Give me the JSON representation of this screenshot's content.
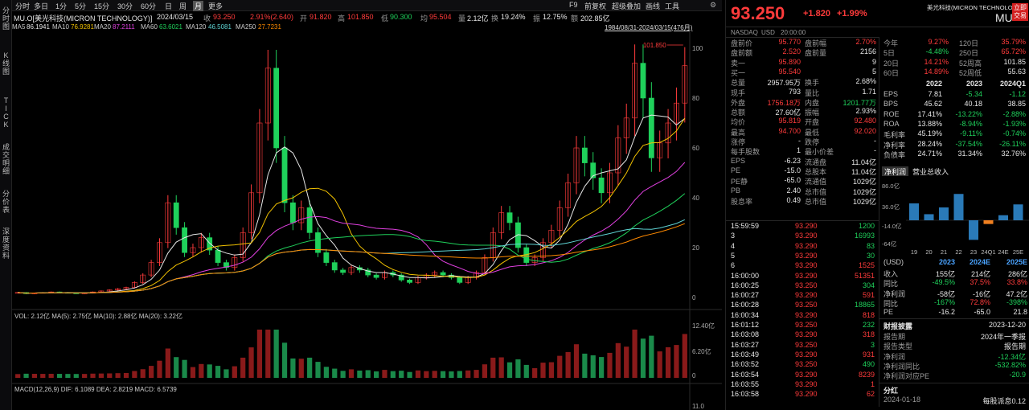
{
  "left_sidebar": [
    "分时图",
    "K线图",
    "TICK",
    "成交明细",
    "分价表",
    "深度资料"
  ],
  "toolbar": {
    "periods": [
      "分时",
      "多日",
      "1分",
      "5分",
      "15分",
      "30分",
      "60分",
      "日",
      "周",
      "月",
      "更多"
    ],
    "active_period": "月",
    "right_items": [
      "F9",
      "前复权",
      "超级叠加",
      "画线",
      "工具"
    ]
  },
  "info": {
    "symbol": "MU.O[美光科技(MICRON TECHNOLOGY)]",
    "date": "2024/03/15",
    "close_label": "收",
    "close": "93.250",
    "change": "2.91%(2.640)",
    "open_label": "开",
    "open": "91.820",
    "high_label": "高",
    "high": "101.850",
    "low_label": "低",
    "low": "90.300",
    "avg_label": "均",
    "avg": "95.504",
    "vol_label": "量",
    "vol": "2.12亿",
    "turnover_label": "换",
    "turnover": "19.24%",
    "amp_label": "振",
    "amp": "12.75%",
    "amount_label": "额",
    "amount": "202.85亿",
    "range": "1984/08/31-2024/03/15(476月)"
  },
  "ma_line": [
    {
      "label": "MA5",
      "value": "86.1941",
      "color": "#e6e6e6"
    },
    {
      "label": "MA10",
      "value": "76.9281",
      "color": "#f2c200"
    },
    {
      "label": "MA20",
      "value": "87.2111",
      "color": "#e040e0"
    },
    {
      "label": "MA60",
      "value": "63.6021",
      "color": "#1fd15b"
    },
    {
      "label": "MA120",
      "value": "46.5081",
      "color": "#5fd5d5"
    },
    {
      "label": "MA250",
      "value": "27.7231",
      "color": "#ff8a00"
    }
  ],
  "chart_data": {
    "type": "candlestick",
    "price_axis_ticks": [
      "100",
      "80",
      "60",
      "40",
      "20",
      "0"
    ],
    "price_ylim": [
      0,
      100
    ],
    "high_annotation": "101.850",
    "price_series_monthly_approx": [
      2,
      1.5,
      1.8,
      2,
      2.2,
      2,
      1.8,
      1.6,
      1.8,
      2.2,
      2.6,
      3,
      3.5,
      4,
      6,
      9,
      14,
      22,
      38,
      28,
      18,
      20,
      24,
      19,
      14,
      12,
      16,
      26,
      42,
      70,
      92,
      60,
      38,
      30,
      36,
      26,
      18,
      14,
      11,
      10,
      12,
      11,
      9,
      8,
      10,
      9,
      7,
      6,
      8,
      9,
      10,
      9,
      8,
      6,
      8,
      10,
      16,
      26,
      34,
      30,
      20,
      14,
      16,
      22,
      27,
      36,
      46,
      60,
      54,
      48,
      42,
      50,
      64,
      72,
      94,
      80,
      56,
      62,
      70,
      78,
      93
    ],
    "volume_label": "VOL: 2.12亿 MA(5): 2.75亿 MA(10): 2.88亿 MA(20): 3.22亿",
    "volume_axis_ticks": [
      "12.40亿",
      "6.20亿",
      "0"
    ],
    "macd_label": "MACD(12,26,9) DIF: 6.1089 DEA: 2.8219 MACD: 6.5739",
    "macd_axis_ticks": [
      "11.0"
    ]
  },
  "quote": {
    "price": "93.250",
    "change": "+1.820",
    "change_pct": "+1.99%",
    "name": "美光科技(MICRON TECHNOLOGY)",
    "ticker": "MU",
    "trade_button": "立即交易",
    "exchange": "NASDAQ",
    "currency": "USD",
    "time": "20:00:00",
    "left_rows": [
      {
        "label": "盘前价",
        "value": "95.770",
        "value2_label": "盘前幅",
        "value2": "2.70%",
        "c1": "red",
        "c2": "red"
      },
      {
        "label": "盘前额",
        "value": "2.520",
        "value2_label": "盘前量",
        "value2": "2156",
        "c1": "red",
        "c2": "white"
      },
      {
        "label": "卖一",
        "value": "95.890",
        "value2_label": "",
        "value2": "9",
        "c1": "red",
        "c2": "white"
      },
      {
        "label": "买一",
        "value": "95.540",
        "value2_label": "",
        "value2": "5",
        "c1": "red",
        "c2": "white"
      },
      {
        "label": "总量",
        "value": "2957.95万",
        "value2_label": "换手",
        "value2": "2.68%",
        "c1": "white",
        "c2": "white"
      },
      {
        "label": "现手",
        "value": "793",
        "value2_label": "量比",
        "value2": "1.71",
        "c1": "white",
        "c2": "white"
      },
      {
        "label": "外盘",
        "value": "1756.18万",
        "value2_label": "内盘",
        "value2": "1201.77万",
        "c1": "red",
        "c2": "green"
      },
      {
        "label": "总额",
        "value": "27.60亿",
        "value2_label": "振幅",
        "value2": "2.93%",
        "c1": "white",
        "c2": "white"
      },
      {
        "label": "均价",
        "value": "95.819",
        "value2_label": "开盘",
        "value2": "92.480",
        "c1": "red",
        "c2": "red"
      },
      {
        "label": "最高",
        "value": "94.700",
        "value2_label": "最低",
        "value2": "92.020",
        "c1": "red",
        "c2": "red"
      },
      {
        "label": "涨停",
        "value": "-",
        "value2_label": "跌停",
        "value2": "-",
        "c1": "white",
        "c2": "white"
      },
      {
        "label": "每手股数",
        "value": "1",
        "value2_label": "最小价差",
        "value2": "-",
        "c1": "white",
        "c2": "white"
      },
      {
        "label": "EPS",
        "value": "-6.23",
        "value2_label": "流通盘",
        "value2": "11.04亿",
        "c1": "white",
        "c2": "white"
      },
      {
        "label": "PE",
        "value": "-15.0",
        "value2_label": "总股本",
        "value2": "11.04亿",
        "c1": "white",
        "c2": "white"
      },
      {
        "label": "PE静",
        "value": "-65.0",
        "value2_label": "流通值",
        "value2": "1029亿",
        "c1": "white",
        "c2": "white"
      },
      {
        "label": "PB",
        "value": "2.40",
        "value2_label": "总市值",
        "value2": "1029亿",
        "c1": "white",
        "c2": "white"
      },
      {
        "label": "股息率",
        "value": "0.49",
        "value2_label": "总市值",
        "value2": "1029亿",
        "c1": "white",
        "c2": "white"
      }
    ],
    "perf": [
      {
        "l1": "今年",
        "v1": "9.27%",
        "l2": "120日",
        "v2": "35.79%"
      },
      {
        "l1": "5日",
        "v1": "-4.48%",
        "l2": "250日",
        "v2": "65.72%"
      },
      {
        "l1": "20日",
        "v1": "14.21%",
        "l2": "52周高",
        "v2": "101.85"
      },
      {
        "l1": "60日",
        "v1": "14.89%",
        "l2": "52周低",
        "v2": "55.63"
      }
    ],
    "fin_head": [
      "",
      "2022",
      "2023",
      "2024Q1"
    ],
    "fin_rows": [
      [
        "EPS",
        "7.81",
        "-5.34",
        "-1.12"
      ],
      [
        "BPS",
        "45.62",
        "40.18",
        "38.85"
      ],
      [
        "ROE",
        "17.41%",
        "-13.22%",
        "-2.88%"
      ],
      [
        "ROA",
        "13.88%",
        "-8.94%",
        "-1.93%"
      ],
      [
        "毛利率",
        "45.19%",
        "-9.11%",
        "-0.74%"
      ],
      [
        "净利率",
        "28.24%",
        "-37.54%",
        "-26.11%"
      ],
      [
        "负债率",
        "24.71%",
        "31.34%",
        "32.76%"
      ]
    ],
    "tabs": [
      "净利润",
      "营业总收入"
    ],
    "bar_chart": {
      "ylabels": [
        "86.0亿",
        "36.0亿",
        "-14.0亿",
        "-64亿"
      ],
      "categories": [
        "19",
        "20",
        "21",
        "22",
        "23",
        "24Q1",
        "24E",
        "25E"
      ],
      "values": [
        50,
        18,
        38,
        78,
        -58,
        -11,
        15,
        47
      ],
      "colors": [
        "#2a7ab8",
        "#2a7ab8",
        "#2a7ab8",
        "#2a7ab8",
        "#2a7ab8",
        "#f08020",
        "#2a7ab8",
        "#2a7ab8"
      ]
    },
    "forecast_head": [
      "(USD)",
      "2023",
      "2024E",
      "2025E"
    ],
    "forecast_rows": [
      [
        "收入",
        "155亿",
        "214亿",
        "286亿"
      ],
      [
        "同比",
        "-49.5%",
        "37.5%",
        "33.8%"
      ],
      [
        "净利润",
        "-58亿",
        "-16亿",
        "47.2亿"
      ],
      [
        "同比",
        "-167%",
        "72.8%",
        "-398%"
      ],
      [
        "PE",
        "-16.2",
        "-65.0",
        "21.8"
      ]
    ],
    "report": {
      "title": "财报披露",
      "date": "2023-12-20",
      "rows": [
        [
          "报告期",
          "2024年一季报"
        ],
        [
          "报告类型",
          "报告期"
        ],
        [
          "净利润",
          "-12.34亿"
        ],
        [
          "净利润同比",
          "-532.82%"
        ],
        [
          "净利润对应PE",
          "-20.9"
        ]
      ]
    },
    "dividend": {
      "title": "分红",
      "date": "2024-01-18",
      "text": "每股派息0.12"
    }
  },
  "ticks": [
    {
      "t": "15:59:59",
      "p": "93.290",
      "v": "1200",
      "pc": "red",
      "vc": "green"
    },
    {
      "t": "3",
      "p": "93.290",
      "v": "16993",
      "pc": "red",
      "vc": "green"
    },
    {
      "t": "4",
      "p": "93.290",
      "v": "83",
      "pc": "red",
      "vc": "green"
    },
    {
      "t": "5",
      "p": "93.290",
      "v": "30",
      "pc": "red",
      "vc": "green"
    },
    {
      "t": "6",
      "p": "93.290",
      "v": "1525",
      "pc": "red",
      "vc": "red"
    },
    {
      "t": "16:00:00",
      "p": "93.290",
      "v": "51351",
      "pc": "red",
      "vc": "red"
    },
    {
      "t": "16:00:25",
      "p": "93.250",
      "v": "304",
      "pc": "red",
      "vc": "green"
    },
    {
      "t": "16:00:27",
      "p": "93.290",
      "v": "591",
      "pc": "red",
      "vc": "red"
    },
    {
      "t": "16:00:28",
      "p": "93.250",
      "v": "18865",
      "pc": "red",
      "vc": "green"
    },
    {
      "t": "16:00:34",
      "p": "93.290",
      "v": "818",
      "pc": "red",
      "vc": "red"
    },
    {
      "t": "16:01:12",
      "p": "93.250",
      "v": "232",
      "pc": "red",
      "vc": "green"
    },
    {
      "t": "16:03:08",
      "p": "93.290",
      "v": "318",
      "pc": "red",
      "vc": "red"
    },
    {
      "t": "16:03:27",
      "p": "93.250",
      "v": "3",
      "pc": "red",
      "vc": "green"
    },
    {
      "t": "16:03:49",
      "p": "93.290",
      "v": "931",
      "pc": "red",
      "vc": "red"
    },
    {
      "t": "16:03:52",
      "p": "93.250",
      "v": "490",
      "pc": "red",
      "vc": "green"
    },
    {
      "t": "16:03:54",
      "p": "93.290",
      "v": "8239",
      "pc": "red",
      "vc": "red"
    },
    {
      "t": "16:03:55",
      "p": "93.290",
      "v": "1",
      "pc": "red",
      "vc": "red"
    },
    {
      "t": "16:03:58",
      "p": "93.290",
      "v": "62",
      "pc": "red",
      "vc": "red"
    }
  ]
}
